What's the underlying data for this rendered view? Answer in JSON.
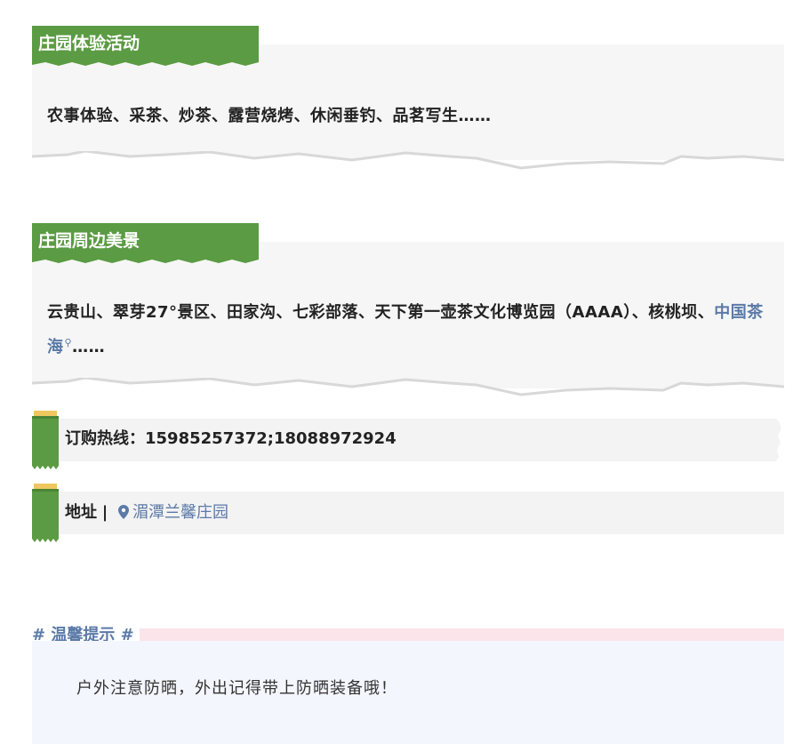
{
  "sections": [
    {
      "title": "庄园体验活动",
      "text": "农事体验、采茶、炒茶、露营烧烤、休闲垂钓、品茗写生……"
    },
    {
      "title": "庄园周边美景",
      "text_before": "云贵山、翠芽27°景区、田家沟、七彩部落、天下第一壶茶文化博览园（AAAA）、核桃坝、",
      "link": "中国茶海",
      "text_after": "……"
    }
  ],
  "order": {
    "label": "订购热线：",
    "phones": "15985257372;18088972924"
  },
  "address": {
    "label": "地址",
    "separator": "|",
    "value": "湄潭兰馨庄园",
    "icon": "location-pin-icon"
  },
  "tips": {
    "heading": "# 温馨提示 #",
    "text": "户外注意防晒，外出记得带上防晒装备哦！"
  },
  "colors": {
    "green": "#5b9b43",
    "blue_text": "#5b7aa7",
    "tag_yellow": "#f0c75e",
    "tips_bg": "#f4f6fd",
    "tips_bar": "#fbe4ea"
  }
}
